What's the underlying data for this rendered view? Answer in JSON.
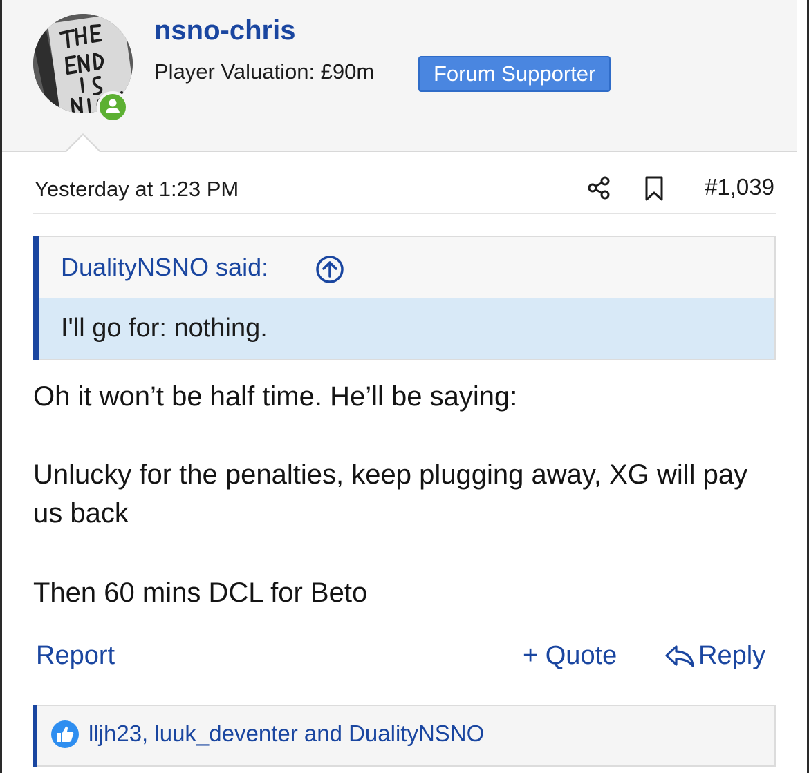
{
  "user": {
    "name": "nsno-chris",
    "valuation": "Player Valuation: £90m",
    "badge": "Forum Supporter",
    "avatar_lettering": "THE END IS NIGH",
    "status_color": "#5cb032"
  },
  "post": {
    "timestamp": "Yesterday at 1:23 PM",
    "number": "#1,039",
    "icons": [
      "share-icon",
      "bookmark-icon"
    ]
  },
  "quote": {
    "author": "DualityNSNO said:",
    "text": "I'll go for: nothing."
  },
  "body": {
    "paragraph_1": "Oh it won’t be half time. He’ll be saying:",
    "paragraph_2": "Unlucky for the penalties, keep plugging away, XG will pay us back",
    "paragraph_3": "Then 60 mins DCL for Beto"
  },
  "actions": {
    "report": "Report",
    "quote": "+ Quote",
    "reply": "Reply"
  },
  "reactions": {
    "text": "lljh23, luuk_deventer and DualityNSNO",
    "icon": "like-icon"
  },
  "colors": {
    "link": "#1a46a0",
    "badge": "#4a86e0",
    "quote_body_bg": "#d8e9f7"
  }
}
